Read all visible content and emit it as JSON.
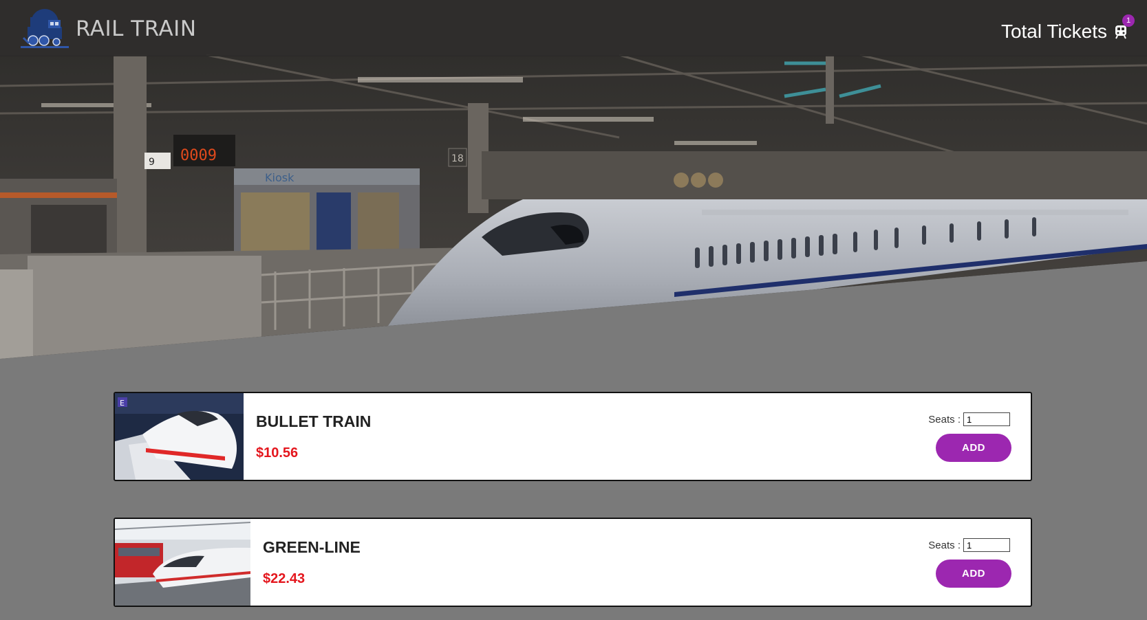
{
  "navbar": {
    "brand": "RAIL TRAIN",
    "cart_label": "Total Tickets",
    "cart_count": "1"
  },
  "hero": {
    "station_counter": "0009",
    "platform_number": "18",
    "kiosk_sign": "Kiosk",
    "platform_sign": "9"
  },
  "trains": [
    {
      "name": "BULLET TRAIN",
      "price": "$10.56",
      "seats_label": "Seats :",
      "seats_value": "1",
      "add_label": "ADD"
    },
    {
      "name": "GREEN-LINE",
      "price": "$22.43",
      "seats_label": "Seats :",
      "seats_value": "1",
      "add_label": "ADD"
    }
  ],
  "colors": {
    "accent": "#9c27b0",
    "price": "#e4161d",
    "navbar": "#302e2d",
    "page_background": "#7a7a7a"
  }
}
